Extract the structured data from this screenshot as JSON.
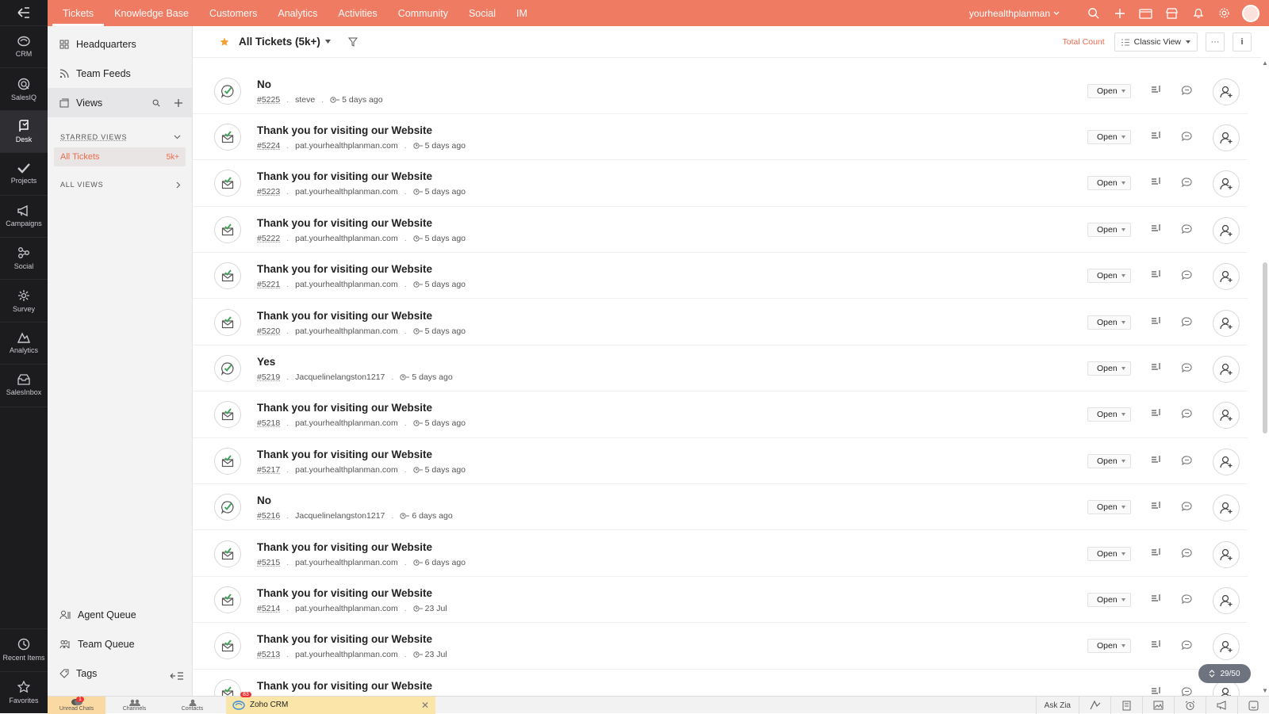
{
  "rail": {
    "items": [
      {
        "label": "CRM",
        "icon": "crm-icon"
      },
      {
        "label": "SalesIQ",
        "icon": "salesiq-icon"
      },
      {
        "label": "Desk",
        "icon": "desk-icon",
        "active": true
      },
      {
        "label": "Projects",
        "icon": "projects-icon"
      },
      {
        "label": "Campaigns",
        "icon": "campaigns-icon"
      },
      {
        "label": "Social",
        "icon": "social-icon"
      },
      {
        "label": "Survey",
        "icon": "survey-icon"
      },
      {
        "label": "Analytics",
        "icon": "analytics-icon"
      },
      {
        "label": "SalesInbox",
        "icon": "salesinbox-icon"
      }
    ],
    "bottom": [
      {
        "label": "Recent Items",
        "icon": "history-icon"
      },
      {
        "label": "Favorites",
        "icon": "star-icon"
      }
    ]
  },
  "topbar": {
    "tabs": [
      "Tickets",
      "Knowledge Base",
      "Customers",
      "Analytics",
      "Activities",
      "Community",
      "Social",
      "IM"
    ],
    "active_tab": "Tickets",
    "portal": "yourhealthplanman",
    "accent": "#ef7b62"
  },
  "sidebar": {
    "headquarters": "Headquarters",
    "team_feeds": "Team Feeds",
    "views": "Views",
    "starred_views": "STARRED VIEWS",
    "starred_item": {
      "label": "All Tickets",
      "count": "5k+"
    },
    "all_views": "ALL VIEWS",
    "agent_queue": "Agent Queue",
    "team_queue": "Team Queue",
    "tags": "Tags"
  },
  "viewbar": {
    "title": "All Tickets (5k+)",
    "total_count": "Total Count",
    "classic_view": "Classic View",
    "more": "···",
    "info": "i"
  },
  "tickets": [
    {
      "subject": "No",
      "number": "#5225",
      "contact": "steve",
      "time": "5 days ago",
      "channel": "chat",
      "status": "Open"
    },
    {
      "subject": "Thank you for visiting our Website",
      "number": "#5224",
      "contact": "pat.yourhealthplanman.com",
      "time": "5 days ago",
      "channel": "email",
      "status": "Open"
    },
    {
      "subject": "Thank you for visiting our Website",
      "number": "#5223",
      "contact": "pat.yourhealthplanman.com",
      "time": "5 days ago",
      "channel": "email",
      "status": "Open"
    },
    {
      "subject": "Thank you for visiting our Website",
      "number": "#5222",
      "contact": "pat.yourhealthplanman.com",
      "time": "5 days ago",
      "channel": "email",
      "status": "Open"
    },
    {
      "subject": "Thank you for visiting our Website",
      "number": "#5221",
      "contact": "pat.yourhealthplanman.com",
      "time": "5 days ago",
      "channel": "email",
      "status": "Open"
    },
    {
      "subject": "Thank you for visiting our Website",
      "number": "#5220",
      "contact": "pat.yourhealthplanman.com",
      "time": "5 days ago",
      "channel": "email",
      "status": "Open"
    },
    {
      "subject": "Yes",
      "number": "#5219",
      "contact": "Jacquelinelangston1217",
      "time": "5 days ago",
      "channel": "chat",
      "status": "Open"
    },
    {
      "subject": "Thank you for visiting our Website",
      "number": "#5218",
      "contact": "pat.yourhealthplanman.com",
      "time": "5 days ago",
      "channel": "email",
      "status": "Open"
    },
    {
      "subject": "Thank you for visiting our Website",
      "number": "#5217",
      "contact": "pat.yourhealthplanman.com",
      "time": "5 days ago",
      "channel": "email",
      "status": "Open"
    },
    {
      "subject": "No",
      "number": "#5216",
      "contact": "Jacquelinelangston1217",
      "time": "6 days ago",
      "channel": "chat",
      "status": "Open"
    },
    {
      "subject": "Thank you for visiting our Website",
      "number": "#5215",
      "contact": "pat.yourhealthplanman.com",
      "time": "6 days ago",
      "channel": "email",
      "status": "Open"
    },
    {
      "subject": "Thank you for visiting our Website",
      "number": "#5214",
      "contact": "pat.yourhealthplanman.com",
      "time": "23 Jul",
      "channel": "email",
      "status": "Open"
    },
    {
      "subject": "Thank you for visiting our Website",
      "number": "#5213",
      "contact": "pat.yourhealthplanman.com",
      "time": "23 Jul",
      "channel": "email",
      "status": "Open"
    },
    {
      "subject": "Thank you for visiting our Website",
      "number": "",
      "contact": "",
      "time": "",
      "channel": "email",
      "status": ""
    }
  ],
  "pagination": "29/50",
  "bottombar": {
    "unread_chats": "Unread Chats",
    "unread_badge": "1",
    "channels": "Channels",
    "contacts": "Contacts",
    "crm_tab": "Zoho CRM",
    "crm_badge": "83",
    "ask_zia": "Ask Zia"
  }
}
